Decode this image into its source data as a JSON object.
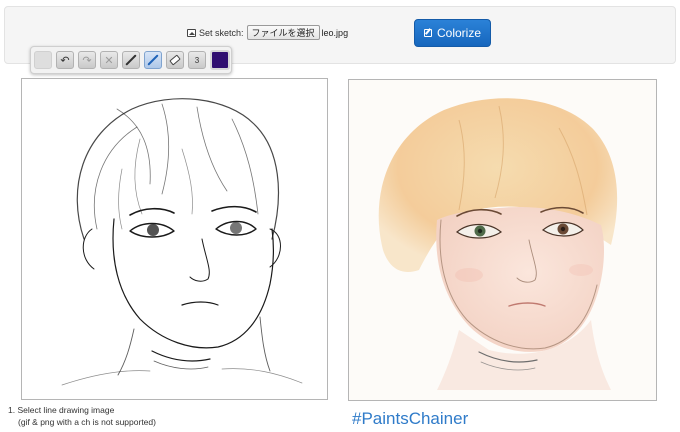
{
  "top_bar": {
    "set_sketch_label": "Set sketch:",
    "file_button_label": "ファイルを選択",
    "file_name": "leo.jpg",
    "colorize_label": "Colorize",
    "colorize_color": "#1a6fc9"
  },
  "toolbar": {
    "tools": [
      {
        "name": "grip",
        "icon": "drag-handle-icon"
      },
      {
        "name": "undo",
        "icon": "undo-icon",
        "glyph": "↶"
      },
      {
        "name": "redo",
        "icon": "redo-icon",
        "glyph": "↷",
        "disabled": true
      },
      {
        "name": "clear",
        "icon": "close-icon",
        "glyph": "✕",
        "disabled": true
      },
      {
        "name": "line",
        "icon": "line-tool-icon"
      },
      {
        "name": "pen",
        "icon": "pen-icon",
        "active": true
      },
      {
        "name": "eraser",
        "icon": "eraser-icon"
      },
      {
        "name": "brush-size",
        "value": "3"
      }
    ],
    "current_color": "#2f0d6f"
  },
  "instructions": {
    "step1": "1. Select line drawing image",
    "step1_note": "(gif & png with a ch is not supported)"
  },
  "brand": {
    "hashtag": "#PaintsChainer",
    "hashtag_color": "#2f7bc9"
  }
}
